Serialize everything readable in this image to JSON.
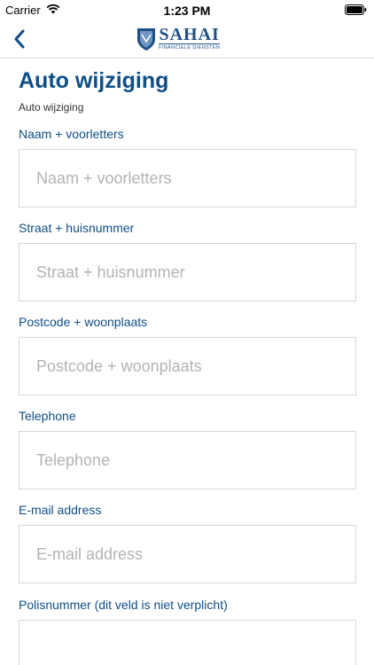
{
  "status_bar": {
    "carrier": "Carrier",
    "time": "1:23 PM"
  },
  "nav": {
    "logo_name": "SAHAI",
    "logo_subtitle": "FINANCIELE DIENSTEN",
    "brand_color": "#1e4f86"
  },
  "page": {
    "title": "Auto wijziging",
    "subtitle": "Auto wijziging"
  },
  "form": {
    "fields": [
      {
        "label": "Naam + voorletters",
        "placeholder": "Naam + voorletters",
        "value": ""
      },
      {
        "label": "Straat + huisnummer",
        "placeholder": "Straat + huisnummer",
        "value": ""
      },
      {
        "label": "Postcode + woonplaats",
        "placeholder": "Postcode + woonplaats",
        "value": ""
      },
      {
        "label": "Telephone",
        "placeholder": "Telephone",
        "value": ""
      },
      {
        "label": "E-mail address",
        "placeholder": "E-mail address",
        "value": ""
      },
      {
        "label": "Polisnummer (dit veld is niet verplicht)",
        "placeholder": "",
        "value": ""
      }
    ]
  }
}
